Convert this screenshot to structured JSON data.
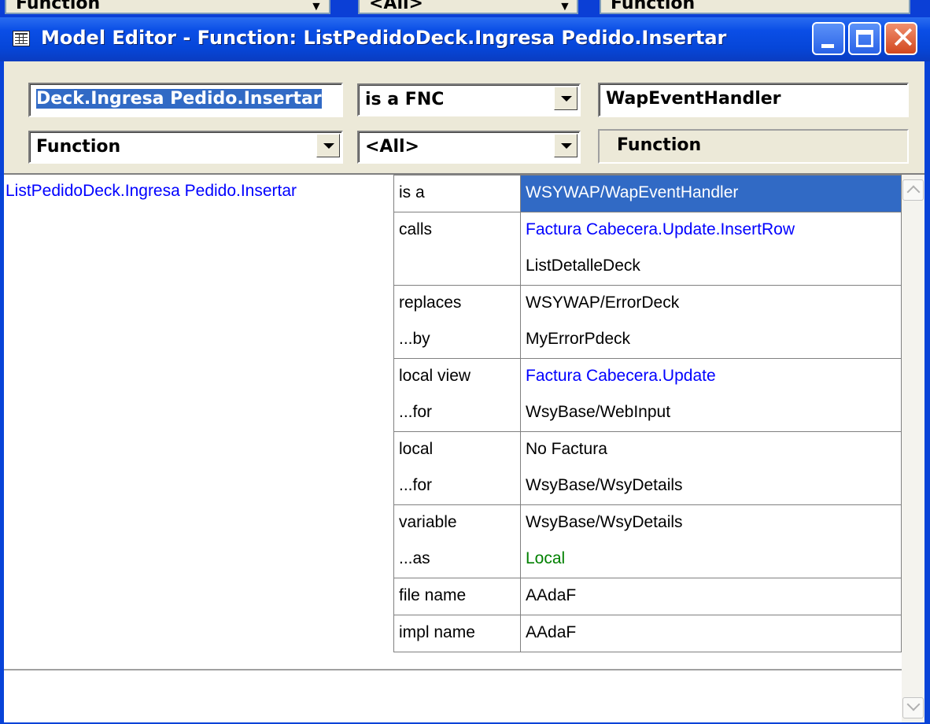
{
  "background_window": {
    "field1": "Function",
    "field2": "<All>",
    "field3": "Function"
  },
  "window": {
    "title": "Model Editor - Function: ListPedidoDeck.Ingresa Pedido.Insertar"
  },
  "toolbar": {
    "object_field": "Deck.Ingresa Pedido.Insertar",
    "verb_select": "is a FNC",
    "target_field": "WapEventHandler",
    "type_select": "Function",
    "filter_select": "<All>",
    "target_type_label": "Function"
  },
  "content": {
    "object": "ListPedidoDeck.Ingresa Pedido.Insertar",
    "rows": [
      {
        "verb": [
          "is a"
        ],
        "values": [
          {
            "text": "WSYWAP/WapEventHandler",
            "color": "selected"
          }
        ]
      },
      {
        "verb": [
          "calls",
          ""
        ],
        "values": [
          {
            "text": "Factura Cabecera.Update.InsertRow",
            "color": "blue"
          },
          {
            "text": "ListDetalleDeck",
            "color": "black"
          }
        ]
      },
      {
        "verb": [
          "replaces",
          "...by"
        ],
        "values": [
          {
            "text": "WSYWAP/ErrorDeck",
            "color": "black"
          },
          {
            "text": "MyErrorPdeck",
            "color": "black"
          }
        ]
      },
      {
        "verb": [
          "local view",
          "...for"
        ],
        "values": [
          {
            "text": "Factura Cabecera.Update",
            "color": "blue"
          },
          {
            "text": "WsyBase/WebInput",
            "color": "black"
          }
        ]
      },
      {
        "verb": [
          "local",
          "...for"
        ],
        "values": [
          {
            "text": "No Factura",
            "color": "black"
          },
          {
            "text": "WsyBase/WsyDetails",
            "color": "black"
          }
        ]
      },
      {
        "verb": [
          "variable",
          "...as"
        ],
        "values": [
          {
            "text": "WsyBase/WsyDetails",
            "color": "black"
          },
          {
            "text": "Local",
            "color": "green"
          }
        ]
      },
      {
        "verb": [
          "file name"
        ],
        "values": [
          {
            "text": "AAdaF",
            "color": "black"
          }
        ]
      },
      {
        "verb": [
          "impl name"
        ],
        "values": [
          {
            "text": "AAdaF",
            "color": "black"
          }
        ]
      }
    ]
  },
  "colors": {
    "selection": "#316ac5",
    "link_blue": "#0000ff",
    "green": "#008000",
    "titlebar": "#0a4ee6"
  },
  "icons": [
    "window-menu-icon",
    "minimize-icon",
    "maximize-icon",
    "close-icon",
    "dropdown-arrow-icon",
    "scroll-up-icon",
    "scroll-down-icon"
  ]
}
